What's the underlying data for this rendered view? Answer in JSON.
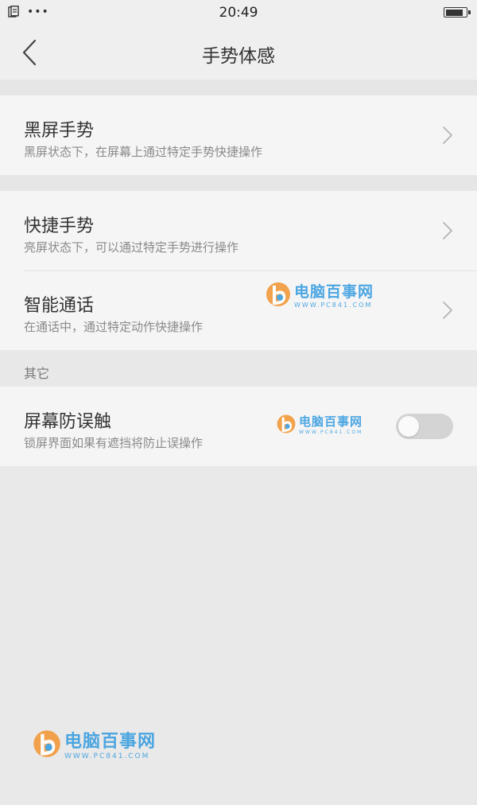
{
  "status_bar": {
    "dots": "•••",
    "time": "20:49",
    "battery_level": 0.9
  },
  "nav": {
    "title": "手势体感"
  },
  "groups": [
    {
      "items": [
        {
          "title": "黑屏手势",
          "desc": "黑屏状态下，在屏幕上通过特定手势快捷操作"
        }
      ]
    },
    {
      "items": [
        {
          "title": "快捷手势",
          "desc": "亮屏状态下，可以通过特定手势进行操作"
        },
        {
          "title": "智能通话",
          "desc": "在通话中，通过特定动作快捷操作"
        }
      ]
    }
  ],
  "other_section": {
    "header": "其它",
    "item": {
      "title": "屏幕防误触",
      "desc": "锁屏界面如果有遮挡将防止误操作",
      "toggle_on": false
    }
  },
  "watermark": {
    "cn": "电脑百事网",
    "en": "WWW.PC841.COM"
  },
  "colors": {
    "background": "#e9e9e9",
    "card": "#f5f5f5",
    "accent": "#3a9ee0",
    "logo_orange": "#f29a3a"
  }
}
